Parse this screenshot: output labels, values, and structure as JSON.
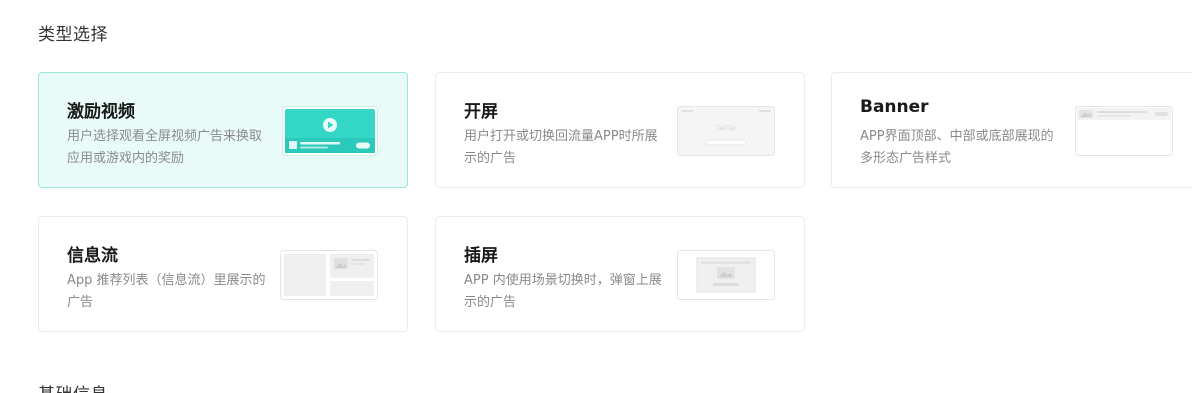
{
  "section": {
    "title": "类型选择",
    "next_title": "基础信息"
  },
  "cards": [
    {
      "title": "激励视频",
      "desc": "用户选择观看全屏视频广告来换取应用或游戏内的奖励",
      "selected": true
    },
    {
      "title": "开屏",
      "desc": "用户打开或切换回流量APP时所展示的广告",
      "thumb_text": "TapTap"
    },
    {
      "title": "Banner",
      "desc": "APP界面顶部、中部或底部展现的多形态广告样式"
    },
    {
      "title": "信息流",
      "desc": "App 推荐列表（信息流）里展示的广告"
    },
    {
      "title": "插屏",
      "desc": "APP 内使用场景切换时，弹窗上展示的广告"
    }
  ],
  "colors": {
    "accent": "#2ed3c3",
    "selected_bg": "#e8fbf8",
    "selected_border": "#9ee5da"
  }
}
